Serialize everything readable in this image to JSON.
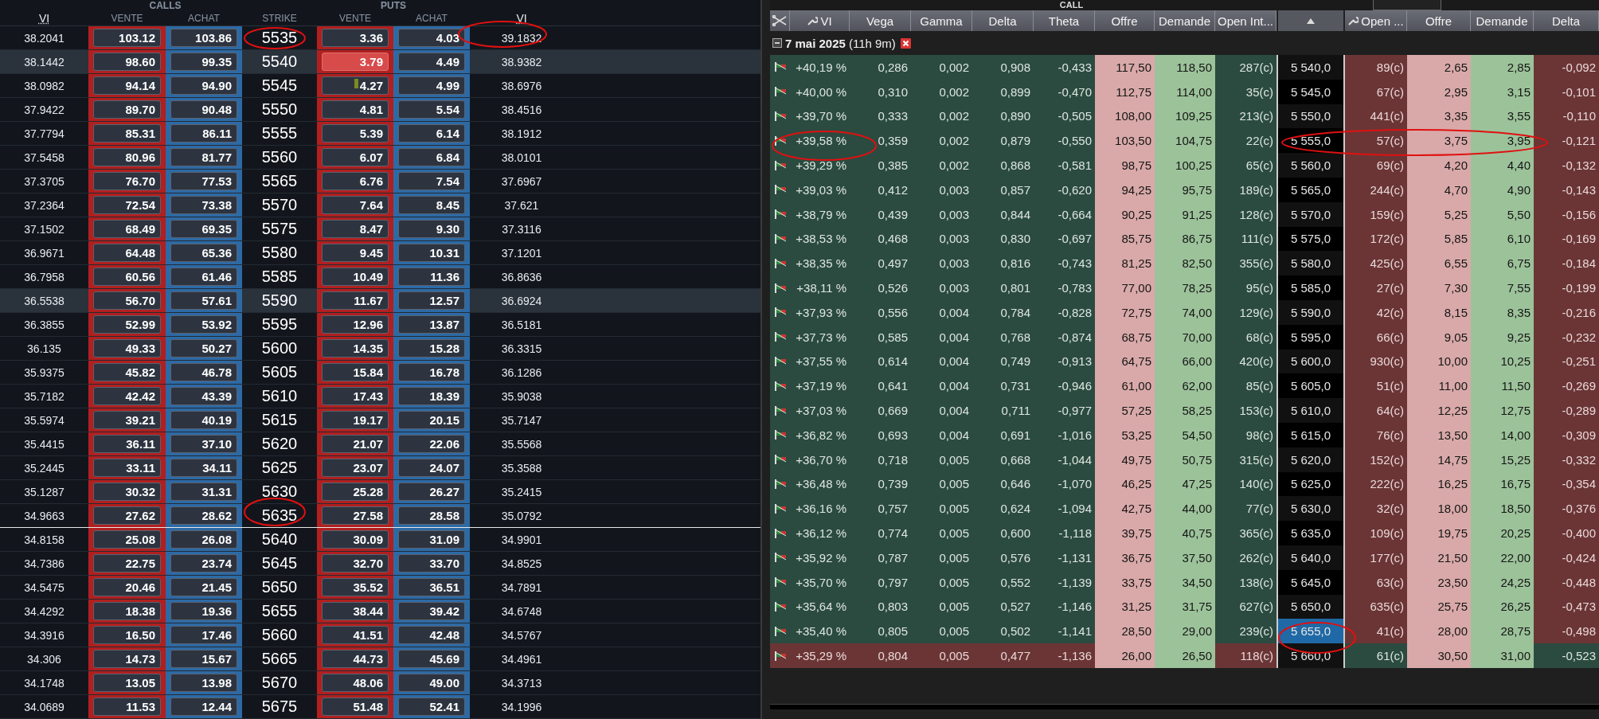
{
  "left_panel": {
    "group_titles": [
      "CALLS",
      "PUTS"
    ],
    "columns": [
      "VI",
      "VENTE",
      "ACHAT",
      "STRIKE",
      "VENTE",
      "ACHAT",
      "VI"
    ],
    "rows": [
      {
        "vi_call": "38.2041",
        "call_sell": "103.12",
        "call_buy": "103.86",
        "strike": "5535",
        "put_sell": "3.36",
        "put_buy": "4.03",
        "vi_put": "39.1832",
        "highlighted": false,
        "put_sell_flash": false,
        "put_sell_tick": false,
        "separator_below": false
      },
      {
        "vi_call": "38.1442",
        "call_sell": "98.60",
        "call_buy": "99.35",
        "strike": "5540",
        "put_sell": "3.79",
        "put_buy": "4.49",
        "vi_put": "38.9382",
        "highlighted": true,
        "put_sell_flash": true,
        "put_sell_tick": false,
        "separator_below": false
      },
      {
        "vi_call": "38.0982",
        "call_sell": "94.14",
        "call_buy": "94.90",
        "strike": "5545",
        "put_sell": "4.27",
        "put_buy": "4.99",
        "vi_put": "38.6976",
        "highlighted": false,
        "put_sell_flash": false,
        "put_sell_tick": true,
        "separator_below": false
      },
      {
        "vi_call": "37.9422",
        "call_sell": "89.70",
        "call_buy": "90.48",
        "strike": "5550",
        "put_sell": "4.81",
        "put_buy": "5.54",
        "vi_put": "38.4516",
        "highlighted": false,
        "put_sell_flash": false,
        "put_sell_tick": false,
        "separator_below": false
      },
      {
        "vi_call": "37.7794",
        "call_sell": "85.31",
        "call_buy": "86.11",
        "strike": "5555",
        "put_sell": "5.39",
        "put_buy": "6.14",
        "vi_put": "38.1912",
        "highlighted": false,
        "put_sell_flash": false,
        "put_sell_tick": false,
        "separator_below": false
      },
      {
        "vi_call": "37.5458",
        "call_sell": "80.96",
        "call_buy": "81.77",
        "strike": "5560",
        "put_sell": "6.07",
        "put_buy": "6.84",
        "vi_put": "38.0101",
        "highlighted": false,
        "put_sell_flash": false,
        "put_sell_tick": false,
        "separator_below": false
      },
      {
        "vi_call": "37.3705",
        "call_sell": "76.70",
        "call_buy": "77.53",
        "strike": "5565",
        "put_sell": "6.76",
        "put_buy": "7.54",
        "vi_put": "37.6967",
        "highlighted": false,
        "put_sell_flash": false,
        "put_sell_tick": false,
        "separator_below": false
      },
      {
        "vi_call": "37.2364",
        "call_sell": "72.54",
        "call_buy": "73.38",
        "strike": "5570",
        "put_sell": "7.64",
        "put_buy": "8.45",
        "vi_put": "37.621",
        "highlighted": false,
        "put_sell_flash": false,
        "put_sell_tick": false,
        "separator_below": false
      },
      {
        "vi_call": "37.1502",
        "call_sell": "68.49",
        "call_buy": "69.35",
        "strike": "5575",
        "put_sell": "8.47",
        "put_buy": "9.30",
        "vi_put": "37.3116",
        "highlighted": false,
        "put_sell_flash": false,
        "put_sell_tick": false,
        "separator_below": false
      },
      {
        "vi_call": "36.9671",
        "call_sell": "64.48",
        "call_buy": "65.36",
        "strike": "5580",
        "put_sell": "9.45",
        "put_buy": "10.31",
        "vi_put": "37.1201",
        "highlighted": false,
        "put_sell_flash": false,
        "put_sell_tick": false,
        "separator_below": false
      },
      {
        "vi_call": "36.7958",
        "call_sell": "60.56",
        "call_buy": "61.46",
        "strike": "5585",
        "put_sell": "10.49",
        "put_buy": "11.36",
        "vi_put": "36.8636",
        "highlighted": false,
        "put_sell_flash": false,
        "put_sell_tick": false,
        "separator_below": false
      },
      {
        "vi_call": "36.5538",
        "call_sell": "56.70",
        "call_buy": "57.61",
        "strike": "5590",
        "put_sell": "11.67",
        "put_buy": "12.57",
        "vi_put": "36.6924",
        "highlighted": true,
        "put_sell_flash": false,
        "put_sell_tick": false,
        "separator_below": false
      },
      {
        "vi_call": "36.3855",
        "call_sell": "52.99",
        "call_buy": "53.92",
        "strike": "5595",
        "put_sell": "12.96",
        "put_buy": "13.87",
        "vi_put": "36.5181",
        "highlighted": false,
        "put_sell_flash": false,
        "put_sell_tick": false,
        "separator_below": false
      },
      {
        "vi_call": "36.135",
        "call_sell": "49.33",
        "call_buy": "50.27",
        "strike": "5600",
        "put_sell": "14.35",
        "put_buy": "15.28",
        "vi_put": "36.3315",
        "highlighted": false,
        "put_sell_flash": false,
        "put_sell_tick": false,
        "separator_below": false
      },
      {
        "vi_call": "35.9375",
        "call_sell": "45.82",
        "call_buy": "46.78",
        "strike": "5605",
        "put_sell": "15.84",
        "put_buy": "16.78",
        "vi_put": "36.1286",
        "highlighted": false,
        "put_sell_flash": false,
        "put_sell_tick": false,
        "separator_below": false
      },
      {
        "vi_call": "35.7182",
        "call_sell": "42.42",
        "call_buy": "43.39",
        "strike": "5610",
        "put_sell": "17.43",
        "put_buy": "18.39",
        "vi_put": "35.9038",
        "highlighted": false,
        "put_sell_flash": false,
        "put_sell_tick": false,
        "separator_below": false
      },
      {
        "vi_call": "35.5974",
        "call_sell": "39.21",
        "call_buy": "40.19",
        "strike": "5615",
        "put_sell": "19.17",
        "put_buy": "20.15",
        "vi_put": "35.7147",
        "highlighted": false,
        "put_sell_flash": false,
        "put_sell_tick": false,
        "separator_below": false
      },
      {
        "vi_call": "35.4415",
        "call_sell": "36.11",
        "call_buy": "37.10",
        "strike": "5620",
        "put_sell": "21.07",
        "put_buy": "22.06",
        "vi_put": "35.5568",
        "highlighted": false,
        "put_sell_flash": false,
        "put_sell_tick": false,
        "separator_below": false
      },
      {
        "vi_call": "35.2445",
        "call_sell": "33.11",
        "call_buy": "34.11",
        "strike": "5625",
        "put_sell": "23.07",
        "put_buy": "24.07",
        "vi_put": "35.3588",
        "highlighted": false,
        "put_sell_flash": false,
        "put_sell_tick": false,
        "separator_below": false
      },
      {
        "vi_call": "35.1287",
        "call_sell": "30.32",
        "call_buy": "31.31",
        "strike": "5630",
        "put_sell": "25.28",
        "put_buy": "26.27",
        "vi_put": "35.2415",
        "highlighted": false,
        "put_sell_flash": false,
        "put_sell_tick": false,
        "separator_below": false
      },
      {
        "vi_call": "34.9663",
        "call_sell": "27.62",
        "call_buy": "28.62",
        "strike": "5635",
        "put_sell": "27.58",
        "put_buy": "28.58",
        "vi_put": "35.0792",
        "highlighted": false,
        "put_sell_flash": false,
        "put_sell_tick": false,
        "separator_below": true
      },
      {
        "vi_call": "34.8158",
        "call_sell": "25.08",
        "call_buy": "26.08",
        "strike": "5640",
        "put_sell": "30.09",
        "put_buy": "31.09",
        "vi_put": "34.9901",
        "highlighted": false,
        "put_sell_flash": false,
        "put_sell_tick": false,
        "separator_below": false
      },
      {
        "vi_call": "34.7386",
        "call_sell": "22.75",
        "call_buy": "23.74",
        "strike": "5645",
        "put_sell": "32.70",
        "put_buy": "33.70",
        "vi_put": "34.8525",
        "highlighted": false,
        "put_sell_flash": false,
        "put_sell_tick": false,
        "separator_below": false
      },
      {
        "vi_call": "34.5475",
        "call_sell": "20.46",
        "call_buy": "21.45",
        "strike": "5650",
        "put_sell": "35.52",
        "put_buy": "36.51",
        "vi_put": "34.7891",
        "highlighted": false,
        "put_sell_flash": false,
        "put_sell_tick": false,
        "separator_below": false
      },
      {
        "vi_call": "34.4292",
        "call_sell": "18.38",
        "call_buy": "19.36",
        "strike": "5655",
        "put_sell": "38.44",
        "put_buy": "39.42",
        "vi_put": "34.6748",
        "highlighted": false,
        "put_sell_flash": false,
        "put_sell_tick": false,
        "separator_below": false
      },
      {
        "vi_call": "34.3916",
        "call_sell": "16.50",
        "call_buy": "17.46",
        "strike": "5660",
        "put_sell": "41.51",
        "put_buy": "42.48",
        "vi_put": "34.5767",
        "highlighted": false,
        "put_sell_flash": false,
        "put_sell_tick": false,
        "separator_below": false
      },
      {
        "vi_call": "34.306",
        "call_sell": "14.73",
        "call_buy": "15.67",
        "strike": "5665",
        "put_sell": "44.73",
        "put_buy": "45.69",
        "vi_put": "34.4961",
        "highlighted": false,
        "put_sell_flash": false,
        "put_sell_tick": false,
        "separator_below": false
      },
      {
        "vi_call": "34.1748",
        "call_sell": "13.05",
        "call_buy": "13.98",
        "strike": "5670",
        "put_sell": "48.06",
        "put_buy": "49.00",
        "vi_put": "34.3713",
        "highlighted": false,
        "put_sell_flash": false,
        "put_sell_tick": false,
        "separator_below": false
      },
      {
        "vi_call": "34.0689",
        "call_sell": "11.53",
        "call_buy": "12.44",
        "strike": "5675",
        "put_sell": "51.48",
        "put_buy": "52.41",
        "vi_put": "34.1996",
        "highlighted": false,
        "put_sell_flash": false,
        "put_sell_tick": false,
        "separator_below": false
      }
    ]
  },
  "right_panel": {
    "section_title": "CALL",
    "call_columns": [
      "VI",
      "Vega",
      "Gamma",
      "Delta",
      "Theta",
      "Offre",
      "Demande",
      "Open Int..."
    ],
    "put_columns": [
      "Open ...",
      "Offre",
      "Demande",
      "Delta"
    ],
    "group": {
      "date": "7 mai 2025",
      "remaining": "(11h 9m)",
      "expanded": true
    },
    "rows": [
      {
        "vi": "+40,19 %",
        "vega": "0,286",
        "gamma": "0,002",
        "delta": "0,908",
        "theta": "-0,433",
        "offer": "117,50",
        "demand": "118,50",
        "open_interest": "287(c)",
        "strike": "5 540,0",
        "put_open_interest": "89(c)",
        "put_offer": "2,65",
        "put_demand": "2,85",
        "put_delta": "-0,092",
        "call_itm": true,
        "put_itm": false,
        "strike_selected": false
      },
      {
        "vi": "+40,00 %",
        "vega": "0,310",
        "gamma": "0,002",
        "delta": "0,899",
        "theta": "-0,470",
        "offer": "112,75",
        "demand": "114,00",
        "open_interest": "35(c)",
        "strike": "5 545,0",
        "put_open_interest": "67(c)",
        "put_offer": "2,95",
        "put_demand": "3,15",
        "put_delta": "-0,101",
        "call_itm": true,
        "put_itm": false,
        "strike_selected": false
      },
      {
        "vi": "+39,70 %",
        "vega": "0,333",
        "gamma": "0,002",
        "delta": "0,890",
        "theta": "-0,505",
        "offer": "108,00",
        "demand": "109,25",
        "open_interest": "213(c)",
        "strike": "5 550,0",
        "put_open_interest": "441(c)",
        "put_offer": "3,35",
        "put_demand": "3,55",
        "put_delta": "-0,110",
        "call_itm": true,
        "put_itm": false,
        "strike_selected": false
      },
      {
        "vi": "+39,58 %",
        "vega": "0,359",
        "gamma": "0,002",
        "delta": "0,879",
        "theta": "-0,550",
        "offer": "103,50",
        "demand": "104,75",
        "open_interest": "22(c)",
        "strike": "5 555,0",
        "put_open_interest": "57(c)",
        "put_offer": "3,75",
        "put_demand": "3,95",
        "put_delta": "-0,121",
        "call_itm": true,
        "put_itm": false,
        "strike_selected": false
      },
      {
        "vi": "+39,29 %",
        "vega": "0,385",
        "gamma": "0,002",
        "delta": "0,868",
        "theta": "-0,581",
        "offer": "98,75",
        "demand": "100,25",
        "open_interest": "65(c)",
        "strike": "5 560,0",
        "put_open_interest": "69(c)",
        "put_offer": "4,20",
        "put_demand": "4,40",
        "put_delta": "-0,132",
        "call_itm": true,
        "put_itm": false,
        "strike_selected": false
      },
      {
        "vi": "+39,03 %",
        "vega": "0,412",
        "gamma": "0,003",
        "delta": "0,857",
        "theta": "-0,620",
        "offer": "94,25",
        "demand": "95,75",
        "open_interest": "189(c)",
        "strike": "5 565,0",
        "put_open_interest": "244(c)",
        "put_offer": "4,70",
        "put_demand": "4,90",
        "put_delta": "-0,143",
        "call_itm": true,
        "put_itm": false,
        "strike_selected": false
      },
      {
        "vi": "+38,79 %",
        "vega": "0,439",
        "gamma": "0,003",
        "delta": "0,844",
        "theta": "-0,664",
        "offer": "90,25",
        "demand": "91,25",
        "open_interest": "128(c)",
        "strike": "5 570,0",
        "put_open_interest": "159(c)",
        "put_offer": "5,25",
        "put_demand": "5,50",
        "put_delta": "-0,156",
        "call_itm": true,
        "put_itm": false,
        "strike_selected": false
      },
      {
        "vi": "+38,53 %",
        "vega": "0,468",
        "gamma": "0,003",
        "delta": "0,830",
        "theta": "-0,697",
        "offer": "85,75",
        "demand": "86,75",
        "open_interest": "111(c)",
        "strike": "5 575,0",
        "put_open_interest": "172(c)",
        "put_offer": "5,85",
        "put_demand": "6,10",
        "put_delta": "-0,169",
        "call_itm": true,
        "put_itm": false,
        "strike_selected": false
      },
      {
        "vi": "+38,35 %",
        "vega": "0,497",
        "gamma": "0,003",
        "delta": "0,816",
        "theta": "-0,743",
        "offer": "81,25",
        "demand": "82,50",
        "open_interest": "355(c)",
        "strike": "5 580,0",
        "put_open_interest": "425(c)",
        "put_offer": "6,55",
        "put_demand": "6,75",
        "put_delta": "-0,184",
        "call_itm": true,
        "put_itm": false,
        "strike_selected": false
      },
      {
        "vi": "+38,11 %",
        "vega": "0,526",
        "gamma": "0,003",
        "delta": "0,801",
        "theta": "-0,783",
        "offer": "77,00",
        "demand": "78,25",
        "open_interest": "95(c)",
        "strike": "5 585,0",
        "put_open_interest": "27(c)",
        "put_offer": "7,30",
        "put_demand": "7,55",
        "put_delta": "-0,199",
        "call_itm": true,
        "put_itm": false,
        "strike_selected": false
      },
      {
        "vi": "+37,93 %",
        "vega": "0,556",
        "gamma": "0,004",
        "delta": "0,784",
        "theta": "-0,828",
        "offer": "72,75",
        "demand": "74,00",
        "open_interest": "129(c)",
        "strike": "5 590,0",
        "put_open_interest": "42(c)",
        "put_offer": "8,15",
        "put_demand": "8,35",
        "put_delta": "-0,216",
        "call_itm": true,
        "put_itm": false,
        "strike_selected": false
      },
      {
        "vi": "+37,73 %",
        "vega": "0,585",
        "gamma": "0,004",
        "delta": "0,768",
        "theta": "-0,874",
        "offer": "68,75",
        "demand": "70,00",
        "open_interest": "68(c)",
        "strike": "5 595,0",
        "put_open_interest": "66(c)",
        "put_offer": "9,05",
        "put_demand": "9,25",
        "put_delta": "-0,232",
        "call_itm": true,
        "put_itm": false,
        "strike_selected": false
      },
      {
        "vi": "+37,55 %",
        "vega": "0,614",
        "gamma": "0,004",
        "delta": "0,749",
        "theta": "-0,913",
        "offer": "64,75",
        "demand": "66,00",
        "open_interest": "420(c)",
        "strike": "5 600,0",
        "put_open_interest": "930(c)",
        "put_offer": "10,00",
        "put_demand": "10,25",
        "put_delta": "-0,251",
        "call_itm": true,
        "put_itm": false,
        "strike_selected": false
      },
      {
        "vi": "+37,19 %",
        "vega": "0,641",
        "gamma": "0,004",
        "delta": "0,731",
        "theta": "-0,946",
        "offer": "61,00",
        "demand": "62,00",
        "open_interest": "85(c)",
        "strike": "5 605,0",
        "put_open_interest": "51(c)",
        "put_offer": "11,00",
        "put_demand": "11,50",
        "put_delta": "-0,269",
        "call_itm": true,
        "put_itm": false,
        "strike_selected": false
      },
      {
        "vi": "+37,03 %",
        "vega": "0,669",
        "gamma": "0,004",
        "delta": "0,711",
        "theta": "-0,977",
        "offer": "57,25",
        "demand": "58,25",
        "open_interest": "153(c)",
        "strike": "5 610,0",
        "put_open_interest": "64(c)",
        "put_offer": "12,25",
        "put_demand": "12,75",
        "put_delta": "-0,289",
        "call_itm": true,
        "put_itm": false,
        "strike_selected": false
      },
      {
        "vi": "+36,82 %",
        "vega": "0,693",
        "gamma": "0,004",
        "delta": "0,691",
        "theta": "-1,016",
        "offer": "53,25",
        "demand": "54,50",
        "open_interest": "98(c)",
        "strike": "5 615,0",
        "put_open_interest": "76(c)",
        "put_offer": "13,50",
        "put_demand": "14,00",
        "put_delta": "-0,309",
        "call_itm": true,
        "put_itm": false,
        "strike_selected": false
      },
      {
        "vi": "+36,70 %",
        "vega": "0,718",
        "gamma": "0,005",
        "delta": "0,668",
        "theta": "-1,044",
        "offer": "49,75",
        "demand": "50,75",
        "open_interest": "315(c)",
        "strike": "5 620,0",
        "put_open_interest": "152(c)",
        "put_offer": "14,75",
        "put_demand": "15,25",
        "put_delta": "-0,332",
        "call_itm": true,
        "put_itm": false,
        "strike_selected": false
      },
      {
        "vi": "+36,48 %",
        "vega": "0,739",
        "gamma": "0,005",
        "delta": "0,646",
        "theta": "-1,070",
        "offer": "46,25",
        "demand": "47,25",
        "open_interest": "140(c)",
        "strike": "5 625,0",
        "put_open_interest": "222(c)",
        "put_offer": "16,25",
        "put_demand": "16,75",
        "put_delta": "-0,354",
        "call_itm": true,
        "put_itm": false,
        "strike_selected": false
      },
      {
        "vi": "+36,16 %",
        "vega": "0,757",
        "gamma": "0,005",
        "delta": "0,624",
        "theta": "-1,094",
        "offer": "42,75",
        "demand": "44,00",
        "open_interest": "77(c)",
        "strike": "5 630,0",
        "put_open_interest": "32(c)",
        "put_offer": "18,00",
        "put_demand": "18,50",
        "put_delta": "-0,376",
        "call_itm": true,
        "put_itm": false,
        "strike_selected": false
      },
      {
        "vi": "+36,12 %",
        "vega": "0,774",
        "gamma": "0,005",
        "delta": "0,600",
        "theta": "-1,118",
        "offer": "39,75",
        "demand": "40,75",
        "open_interest": "365(c)",
        "strike": "5 635,0",
        "put_open_interest": "109(c)",
        "put_offer": "19,75",
        "put_demand": "20,25",
        "put_delta": "-0,400",
        "call_itm": true,
        "put_itm": false,
        "strike_selected": false
      },
      {
        "vi": "+35,92 %",
        "vega": "0,787",
        "gamma": "0,005",
        "delta": "0,576",
        "theta": "-1,131",
        "offer": "36,75",
        "demand": "37,50",
        "open_interest": "262(c)",
        "strike": "5 640,0",
        "put_open_interest": "177(c)",
        "put_offer": "21,50",
        "put_demand": "22,00",
        "put_delta": "-0,424",
        "call_itm": true,
        "put_itm": false,
        "strike_selected": false
      },
      {
        "vi": "+35,70 %",
        "vega": "0,797",
        "gamma": "0,005",
        "delta": "0,552",
        "theta": "-1,139",
        "offer": "33,75",
        "demand": "34,50",
        "open_interest": "138(c)",
        "strike": "5 645,0",
        "put_open_interest": "63(c)",
        "put_offer": "23,50",
        "put_demand": "24,25",
        "put_delta": "-0,448",
        "call_itm": true,
        "put_itm": false,
        "strike_selected": false
      },
      {
        "vi": "+35,64 %",
        "vega": "0,803",
        "gamma": "0,005",
        "delta": "0,527",
        "theta": "-1,146",
        "offer": "31,25",
        "demand": "31,75",
        "open_interest": "627(c)",
        "strike": "5 650,0",
        "put_open_interest": "635(c)",
        "put_offer": "25,75",
        "put_demand": "26,25",
        "put_delta": "-0,473",
        "call_itm": true,
        "put_itm": false,
        "strike_selected": false
      },
      {
        "vi": "+35,40 %",
        "vega": "0,805",
        "gamma": "0,005",
        "delta": "0,502",
        "theta": "-1,141",
        "offer": "28,50",
        "demand": "29,00",
        "open_interest": "239(c)",
        "strike": "5 655,0",
        "put_open_interest": "41(c)",
        "put_offer": "28,00",
        "put_demand": "28,75",
        "put_delta": "-0,498",
        "call_itm": true,
        "put_itm": false,
        "strike_selected": true
      },
      {
        "vi": "+35,29 %",
        "vega": "0,804",
        "gamma": "0,005",
        "delta": "0,477",
        "theta": "-1,136",
        "offer": "26,00",
        "demand": "26,50",
        "open_interest": "118(c)",
        "strike": "5 660,0",
        "put_open_interest": "61(c)",
        "put_offer": "30,50",
        "put_demand": "31,00",
        "put_delta": "-0,523",
        "call_itm": false,
        "put_itm": true,
        "strike_selected": false
      }
    ]
  }
}
